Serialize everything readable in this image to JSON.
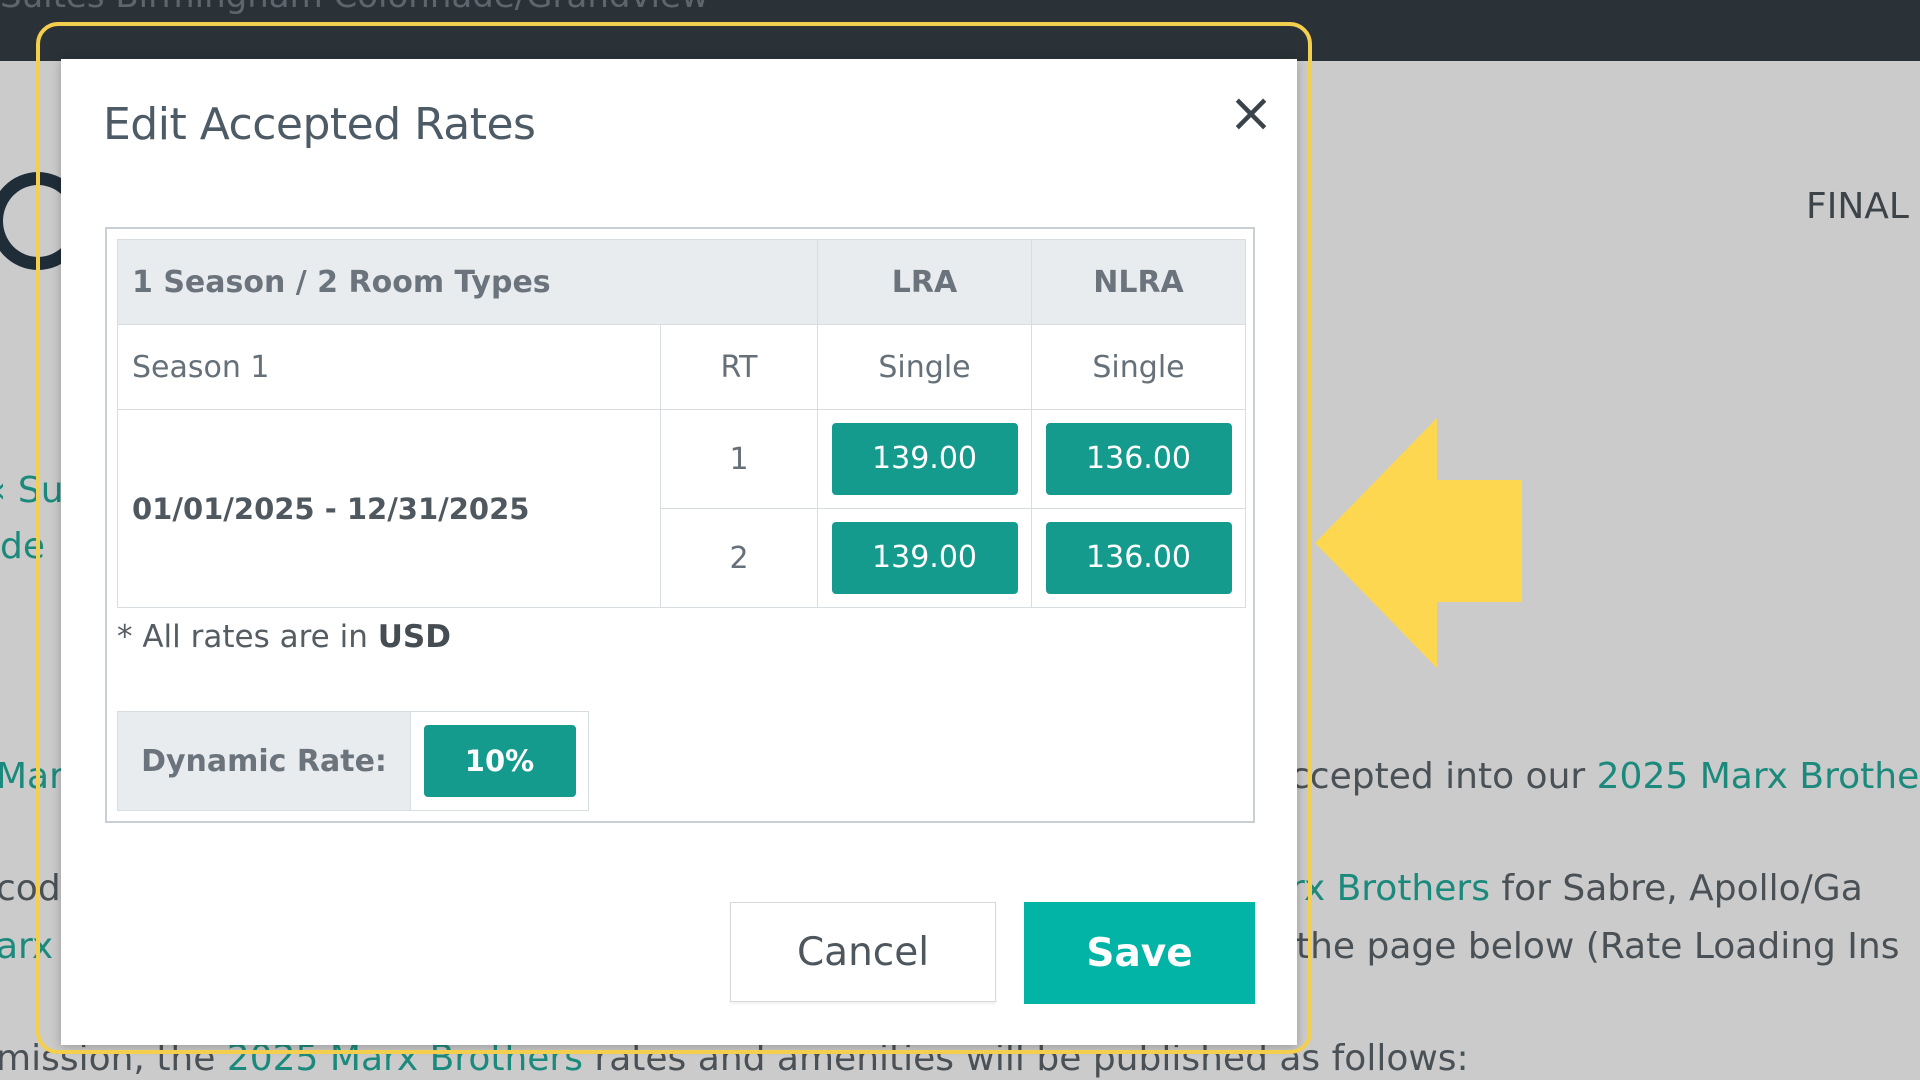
{
  "background": {
    "top_bar_title": "Suites Birmingham Colonnade/Grandview",
    "status_label": "FINAL",
    "left_fragments": [
      "‹ Su",
      "de",
      "Mar",
      "cod",
      "arx"
    ],
    "paragraph_1": {
      "prefix": "ccepted into our ",
      "link": "2025 Marx Brothe"
    },
    "paragraph_2": {
      "link": "rx Brothers",
      "suffix": " for Sabre, Apollo/Ga"
    },
    "paragraph_3": "the page below (Rate Loading Ins",
    "paragraph_4": {
      "prefix": "mission, the ",
      "link": "2025 Marx Brothers",
      "suffix": " rates and amenities will be published as follows:"
    }
  },
  "modal": {
    "title": "Edit Accepted Rates",
    "close_symbol": "×",
    "table": {
      "header": {
        "summary": "1 Season / 2 Room Types",
        "col_lra": "LRA",
        "col_nlra": "NLRA"
      },
      "subheader": {
        "season": "Season 1",
        "rt": "RT",
        "lra_type": "Single",
        "nlra_type": "Single"
      },
      "date_range": "01/01/2025 - 12/31/2025",
      "rows": [
        {
          "rt": "1",
          "lra": "139.00",
          "nlra": "136.00"
        },
        {
          "rt": "2",
          "lra": "139.00",
          "nlra": "136.00"
        }
      ]
    },
    "currency_note": {
      "prefix": "* All rates are in ",
      "currency": "USD"
    },
    "dynamic_rate": {
      "label": "Dynamic Rate:",
      "value": "10%"
    },
    "buttons": {
      "cancel": "Cancel",
      "save": "Save"
    }
  },
  "colors": {
    "accent_teal": "#149b8e",
    "save_teal": "#02b4a5",
    "highlight_yellow": "#f4cf4e"
  }
}
